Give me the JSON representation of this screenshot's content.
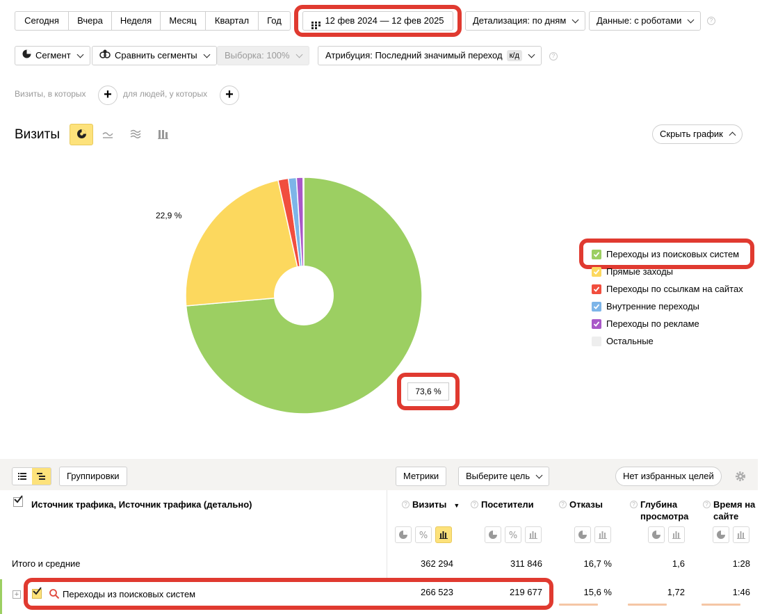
{
  "toolbar": {
    "periods": [
      "Сегодня",
      "Вчера",
      "Неделя",
      "Месяц",
      "Квартал",
      "Год"
    ],
    "date_range": "12 фев 2024 — 12 фев 2025",
    "detail": "Детализация: по дням",
    "data_mode": "Данные: с роботами"
  },
  "toolbar2": {
    "segment": "Сегмент",
    "compare": "Сравнить сегменты",
    "sample": "Выборка: 100%",
    "attribution": "Атрибуция: Последний значимый переход",
    "attribution_badge": "к/д"
  },
  "filters": {
    "visits_label": "Визиты, в которых",
    "people_label": "для людей, у которых"
  },
  "chart_header": {
    "title": "Визиты",
    "hide_chart": "Скрыть график"
  },
  "chart_data": {
    "type": "pie",
    "categories": [
      "Переходы из поисковых систем",
      "Прямые заходы",
      "Переходы по ссылкам на сайтах",
      "Внутренние переходы",
      "Переходы по рекламе",
      "Остальные"
    ],
    "values": [
      73.6,
      22.9,
      1.4,
      1.1,
      0.9,
      0.1
    ],
    "colors": [
      "#9ccf62",
      "#fcd85e",
      "#f14e3e",
      "#7db5e8",
      "#a958c8",
      "#e8e8e8"
    ],
    "data_labels": [
      "73,6 %",
      "22,9 %"
    ],
    "legend_position": "right"
  },
  "legend": {
    "items": [
      {
        "label": "Переходы из поисковых систем",
        "color": "#9ccf62",
        "checked": true
      },
      {
        "label": "Прямые заходы",
        "color": "#fcd85e",
        "checked": true
      },
      {
        "label": "Переходы по ссылкам на сайтах",
        "color": "#f14e3e",
        "checked": true
      },
      {
        "label": "Внутренние переходы",
        "color": "#7db5e8",
        "checked": true
      },
      {
        "label": "Переходы по рекламе",
        "color": "#a958c8",
        "checked": true
      },
      {
        "label": "Остальные",
        "color": "#eeeeee",
        "checked": false
      }
    ]
  },
  "table": {
    "groupings_btn": "Группировки",
    "metrics_btn": "Метрики",
    "goal_btn": "Выберите цель",
    "favorites_btn": "Нет избранных целей",
    "dimension_header": "Источник трафика, Источник трафика (детально)",
    "columns": [
      "Визиты",
      "Посетители",
      "Отказы",
      "Глубина просмотра",
      "Время на сайте"
    ],
    "totals_label": "Итого и средние",
    "totals": [
      "362 294",
      "311 846",
      "16,7 %",
      "1,6",
      "1:28"
    ],
    "rows": [
      {
        "label": "Переходы из поисковых систем",
        "values": [
          "266 523",
          "219 677",
          "15,6 %",
          "1,72",
          "1:46"
        ]
      }
    ]
  }
}
